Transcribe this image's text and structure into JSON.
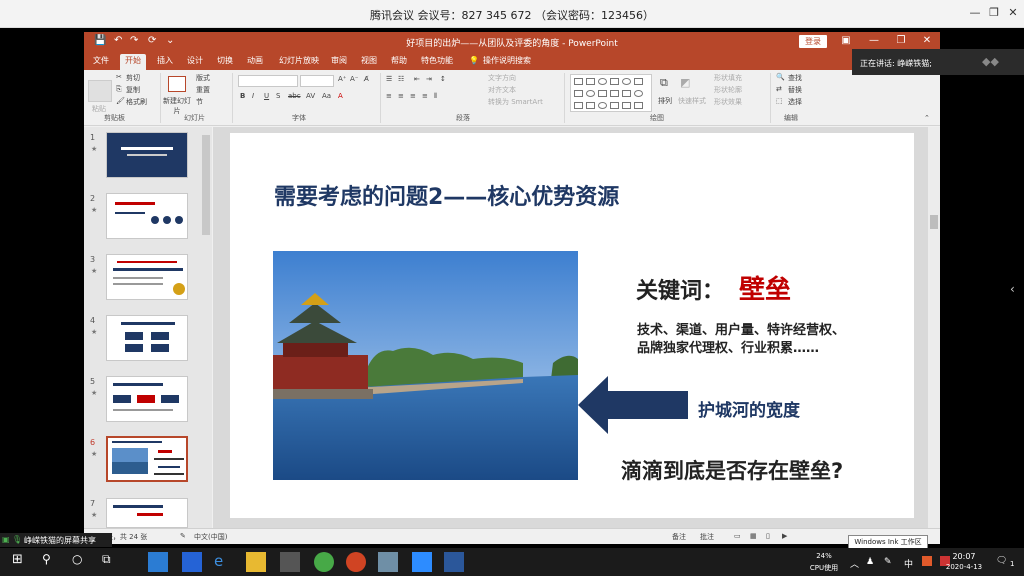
{
  "meeting_bar": {
    "title": "腾讯会议 会议号：827 345 672 （会议密码：123456）",
    "controls": [
      "—",
      "❐",
      "✕"
    ]
  },
  "ppt": {
    "title": "好项目的出炉——从团队及评委的角度  -  PowerPoint",
    "login": "登录",
    "quick_access": [
      "💾",
      "↶",
      "↷",
      "⟳",
      "⌄"
    ],
    "window_controls": [
      "▣",
      "—",
      "❐",
      "✕"
    ],
    "tabs": [
      "文件",
      "开始",
      "插入",
      "设计",
      "切换",
      "动画",
      "幻灯片放映",
      "审阅",
      "视图",
      "帮助",
      "特色功能"
    ],
    "search_hint": "操作说明搜索",
    "ribbon": {
      "paste": "粘贴",
      "cut": "剪切",
      "copy": "复制",
      "format_painter": "格式刷",
      "clipboard_group": "剪贴板",
      "new_slide": "新建幻灯片",
      "layout": "版式",
      "reset": "重置",
      "section": "节",
      "slides_group": "幻灯片",
      "font_group": "字体",
      "text_direction": "文字方向",
      "align_text": "对齐文本",
      "smartart": "转换为 SmartArt",
      "paragraph_group": "段落",
      "arrange": "排列",
      "quick_styles": "快速样式",
      "shape_fill": "形状填充",
      "shape_outline": "形状轮廓",
      "shape_effects": "形状效果",
      "drawing_group": "绘图",
      "find": "查找",
      "replace": "替换",
      "select": "选择",
      "editing_group": "编辑"
    },
    "slide_numbers": [
      "1",
      "2",
      "3",
      "4",
      "5",
      "6",
      "7"
    ],
    "status": {
      "slide_count": "第 6 张，共 24 张",
      "language": "中文(中国)",
      "notes": "备注",
      "comments": "批注"
    }
  },
  "slide": {
    "title": "需要考虑的问题2——核心优势资源",
    "keyword_label": "关键词：",
    "keyword_value": "壁垒",
    "line1": "技术、渠道、用户量、特许经营权、",
    "line2": "品牌独家代理权、行业积累……",
    "moat": "护城河的宽度",
    "question": "滴滴到底是否存在壁垒?"
  },
  "overlay": {
    "speaking": "正在讲话: 峥嵘铁猫;",
    "share": "峥嵘铁猫的屏幕共享",
    "ink_tip": "Windows Ink 工作区"
  },
  "taskbar": {
    "cpu_percent": "24%",
    "cpu_label": "CPU使用",
    "ime": "中",
    "time": "20:07",
    "date": "2020-4-13",
    "notifications": "1"
  },
  "colors": {
    "ppt_red": "#b7472a",
    "title_navy": "#1f3864",
    "keyword_red": "#c00000"
  }
}
